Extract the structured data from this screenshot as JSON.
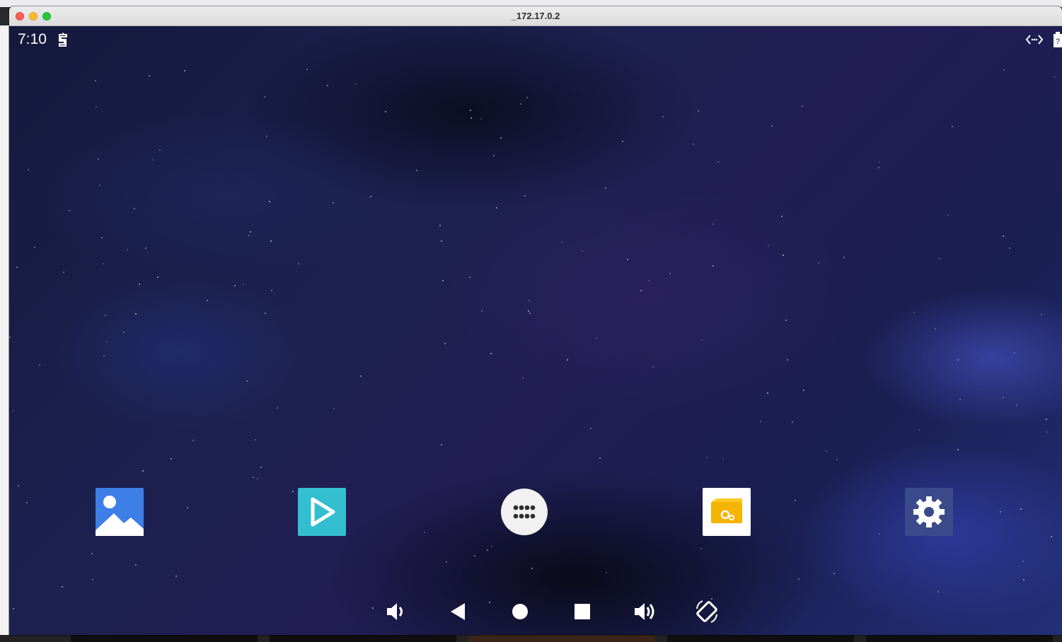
{
  "window": {
    "title": "_172.17.0.2"
  },
  "status_bar": {
    "time": "7:10",
    "icons": [
      "notification-icon",
      "nav-arrows-icon",
      "battery-icon"
    ]
  },
  "dock": {
    "apps": [
      {
        "icon": "gallery-icon",
        "bg": "#ffffff",
        "accent": "#3d7fe6"
      },
      {
        "icon": "video-play-icon",
        "bg": "#33bfd0",
        "accent": "#ffffff"
      },
      {
        "icon": "app-drawer-icon",
        "bg": "#f1f1f1",
        "accent": "#2d2d2d"
      },
      {
        "icon": "dev-tools-icon",
        "bg": "#ffffff",
        "accent": "#f5b400"
      },
      {
        "icon": "settings-gear-icon",
        "bg": "#3b4a8a",
        "accent": "#ffffff"
      }
    ]
  },
  "nav_bar": {
    "buttons": [
      "volume-down-icon",
      "back-icon",
      "home-icon",
      "recents-icon",
      "volume-up-icon",
      "rotate-icon"
    ]
  },
  "colors": {
    "wallpaper_base": "#1b1f4a",
    "icon_fg": "#ffffff"
  }
}
